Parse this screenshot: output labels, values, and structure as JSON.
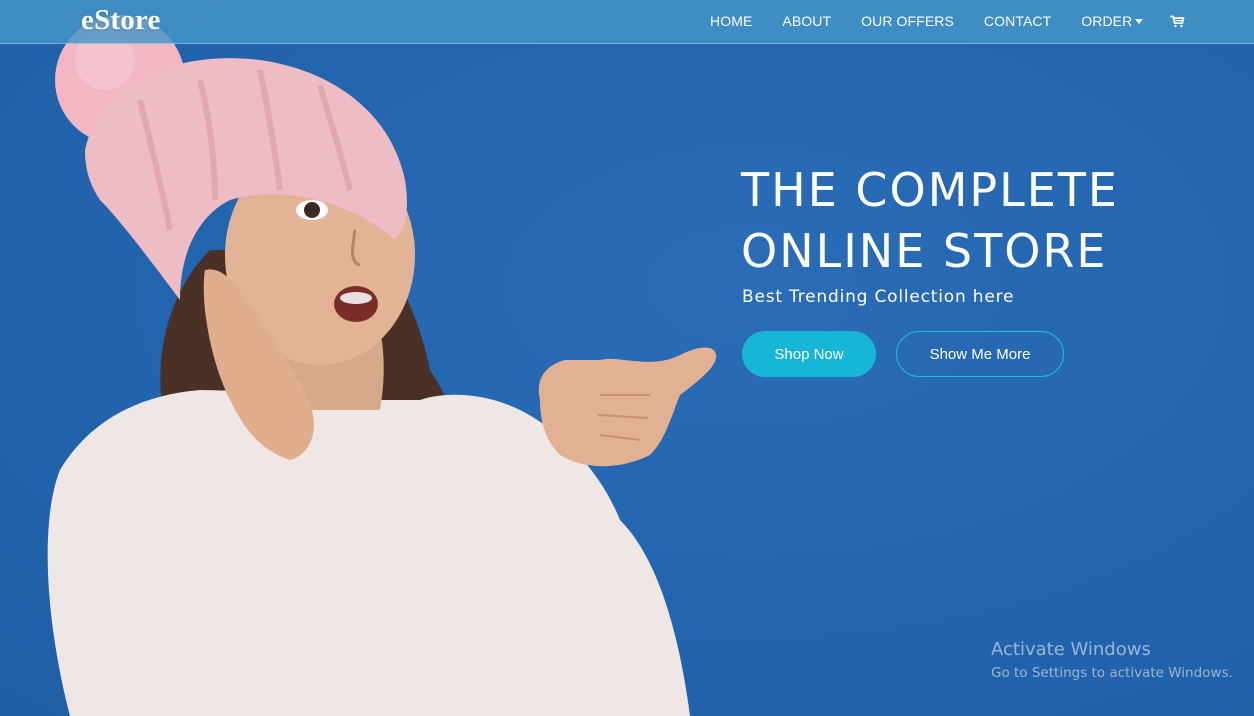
{
  "brand": "eStore",
  "nav": {
    "items": [
      {
        "label": "HOME"
      },
      {
        "label": "ABOUT"
      },
      {
        "label": "OUR OFFERS"
      },
      {
        "label": "CONTACT"
      },
      {
        "label": "ORDER"
      }
    ],
    "cart_icon": "shopping-cart-icon",
    "dropdown_icon": "caret-down-icon"
  },
  "hero": {
    "headline_line1": "THE COMPLETE",
    "headline_line2": "ONLINE STORE",
    "subline": "Best Trending Collection here",
    "primary_button": "Shop Now",
    "secondary_button": "Show Me More",
    "colors": {
      "background": "#2266b0",
      "accent": "#17b5d6",
      "navbar": "#4496c8"
    }
  },
  "watermark": {
    "title": "Activate Windows",
    "subtitle": "Go to Settings to activate Windows."
  }
}
